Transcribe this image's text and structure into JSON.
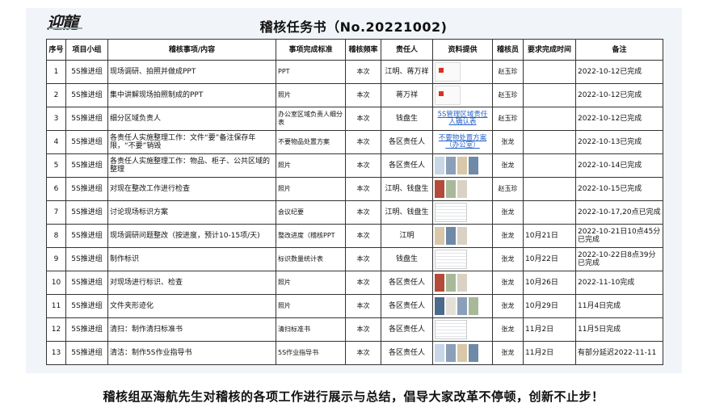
{
  "brand": {
    "logo_text": "迎龍"
  },
  "title": "稽核任务书（No.20221002)",
  "headers": [
    "序号",
    "项目小组",
    "稽核事项/内容",
    "事项完成标准",
    "稽核频率",
    "责任人",
    "资料提供",
    "稽核员",
    "要求完成时间",
    "备注"
  ],
  "rows": [
    {
      "no": "1",
      "group": "5S推进组",
      "content": "现场调研、拍照并做成PPT",
      "standard": "PPT",
      "freq": "本次",
      "owner": "江明、蒋万祥",
      "materials": {
        "type": "doc"
      },
      "auditor": "赵玉珍",
      "due": "",
      "note": "2022-10-12已完成"
    },
    {
      "no": "2",
      "group": "5S推进组",
      "content": "集中讲解现场拍照制成的PPT",
      "standard": "照片",
      "freq": "本次",
      "owner": "蒋万祥",
      "materials": {
        "type": "doc"
      },
      "auditor": "赵玉珍",
      "due": "",
      "note": "2022-10-12已完成"
    },
    {
      "no": "3",
      "group": "5S推进组",
      "content": "细分区域负责人",
      "standard": "办公室区域负责人细分表",
      "freq": "本次",
      "owner": "钱盘生",
      "materials": {
        "type": "link",
        "text": "5S管理区域责任人确认表"
      },
      "auditor": "赵玉珍",
      "due": "",
      "note": "2022-10-12已完成"
    },
    {
      "no": "4",
      "group": "5S推进组",
      "content": "各责任人实施整理工作：文件“要”备注保存年限，“不要”销毁",
      "standard": "不要物品处置方案",
      "freq": "本次",
      "owner": "各区责任人",
      "materials": {
        "type": "link",
        "text": "不要物处置方案（办公室）"
      },
      "auditor": "张龙",
      "due": "",
      "note": "2022-10-13已完成"
    },
    {
      "no": "5",
      "group": "5S推进组",
      "content": "各责任人实施整理工作：物品、柜子、公共区域的整理",
      "standard": "照片",
      "freq": "本次",
      "owner": "各区责任人",
      "materials": {
        "type": "photos"
      },
      "auditor": "张龙",
      "due": "",
      "note": "2022-10-14已完成"
    },
    {
      "no": "6",
      "group": "5S推进组",
      "content": "对现在整改工作进行检查",
      "standard": "照片",
      "freq": "本次",
      "owner": "江明、钱盘生",
      "materials": {
        "type": "photos"
      },
      "auditor": "赵玉珍",
      "due": "",
      "note": "2022-10-15已完成"
    },
    {
      "no": "7",
      "group": "5S推进组",
      "content": "讨论现场标识方案",
      "standard": "会议纪要",
      "freq": "本次",
      "owner": "江明、钱盘生",
      "materials": {
        "type": "sheet"
      },
      "auditor": "张龙",
      "due": "",
      "note": "2022-10-17,20点已完成"
    },
    {
      "no": "8",
      "group": "5S推进组",
      "content": "现场调研问题整改（按进度，预计10-15项/天)",
      "standard": "整改进度（稽核PPT",
      "freq": "本次",
      "owner": "江明",
      "materials": {
        "type": "photos"
      },
      "auditor": "张龙",
      "due": "10月21日",
      "note": "2022-10-21日10点45分已完成"
    },
    {
      "no": "9",
      "group": "5S推进组",
      "content": "制作标识",
      "standard": "标识数量统计表",
      "freq": "本次",
      "owner": "钱盘生",
      "materials": {
        "type": "sheet"
      },
      "auditor": "张龙",
      "due": "10月22日",
      "note": "2022-10-22日8点39分已完成"
    },
    {
      "no": "10",
      "group": "5S推进组",
      "content": "对现场进行标识、检查",
      "standard": "照片",
      "freq": "本次",
      "owner": "各区责任人",
      "materials": {
        "type": "photos"
      },
      "auditor": "张龙",
      "due": "10月26日",
      "note": "2022-11-10完成"
    },
    {
      "no": "11",
      "group": "5S推进组",
      "content": "文件夹形迹化",
      "standard": "照片",
      "freq": "本次",
      "owner": "各区责任人",
      "materials": {
        "type": "photos"
      },
      "auditor": "张龙",
      "due": "10月29日",
      "note": "11月4日完成"
    },
    {
      "no": "12",
      "group": "5S推进组",
      "content": "清扫：制作清扫标准书",
      "standard": "清扫标准书",
      "freq": "本次",
      "owner": "各区责任人",
      "materials": {
        "type": "sheet"
      },
      "auditor": "张龙",
      "due": "11月2日",
      "note": "11月5日完成"
    },
    {
      "no": "13",
      "group": "5S推进组",
      "content": "清洁：制作5S作业指导书",
      "standard": "5S作业指导书",
      "freq": "本次",
      "owner": "各区责任人",
      "materials": {
        "type": "photos"
      },
      "auditor": "张龙",
      "due": "11月2日",
      "note": "有部分延迟2022-11-11"
    }
  ],
  "caption": "稽核组巫海航先生对稽核的各项工作进行展示与总结，倡导大家改革不停顿，创新不止步！"
}
